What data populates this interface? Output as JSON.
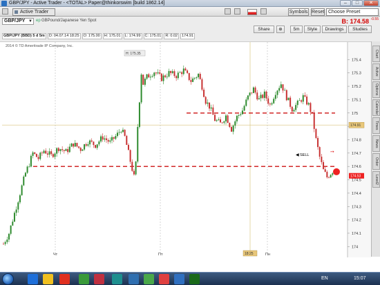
{
  "window": {
    "title": "GBP/JPY - Active Trader - <TOTAL> Paper@thinkorswim [build 1862.14]",
    "controls": {
      "minimize": "–",
      "maximize": "□",
      "close": "✕"
    }
  },
  "toolbar": {
    "active_tab": "Active Trader",
    "symbols_label": "Symbols",
    "reset_label": "Reset",
    "choose_preset_label": "Choose Preset"
  },
  "chart_header": {
    "symbol": "GBP/JPY",
    "edit_indicator": "ep",
    "description": "GBPound/Japanese Yen Spot",
    "buttons": {
      "share": "Share",
      "interval": "5m",
      "style": "Style",
      "drawings": "Drawings",
      "studies": "Studies"
    },
    "bid_text": "B: 174.58",
    "bid_change": "-0.55",
    "ohlc": {
      "symbol": "GBP/JPY (BBD) 5 d 5m",
      "date": "D: 04.07.14 18:25",
      "open": "O: 175.00",
      "high": "H: 175.01",
      "low": "L: 174.99",
      "close": "C: 175.01",
      "range": "R: 0.02",
      "last": "174.91"
    },
    "copyright": "2014 © TD Ameritrade IP Company, Inc."
  },
  "chart_data": {
    "type": "candlestick",
    "title": "",
    "xlabel": "",
    "ylabel": "",
    "ylim": [
      173.95,
      175.5
    ],
    "yticks": [
      "175.4",
      "175.3",
      "175.2",
      "175.1",
      "175",
      "174.9",
      "174.8",
      "174.7",
      "174.6",
      "174.5",
      "174.4",
      "174.3",
      "174.2",
      "174.1",
      "174"
    ],
    "xticks": [
      "Чт",
      "Пт",
      "Пн"
    ],
    "series": [
      {
        "keyframes": [
          [
            0,
            174.02
          ],
          [
            3,
            174.1
          ],
          [
            6,
            174.25
          ],
          [
            9,
            174.4
          ],
          [
            12,
            174.55
          ],
          [
            14,
            174.62
          ],
          [
            16,
            174.7
          ],
          [
            19,
            174.66
          ],
          [
            22,
            174.72
          ],
          [
            26,
            174.68
          ],
          [
            30,
            174.74
          ],
          [
            34,
            174.71
          ],
          [
            38,
            174.77
          ],
          [
            42,
            174.73
          ],
          [
            46,
            174.79
          ],
          [
            50,
            174.76
          ],
          [
            54,
            174.82
          ],
          [
            58,
            174.78
          ],
          [
            62,
            174.84
          ],
          [
            64,
            174.88
          ],
          [
            66,
            174.82
          ],
          [
            68,
            174.7
          ],
          [
            70,
            174.58
          ],
          [
            71,
            174.52
          ],
          [
            72,
            174.62
          ],
          [
            73,
            174.9
          ],
          [
            74,
            175.1
          ],
          [
            75,
            175.3
          ],
          [
            76,
            175.22
          ],
          [
            78,
            175.27
          ],
          [
            82,
            175.31
          ],
          [
            86,
            175.26
          ],
          [
            90,
            175.3
          ],
          [
            94,
            175.28
          ],
          [
            98,
            175.32
          ],
          [
            102,
            175.24
          ],
          [
            106,
            175.29
          ],
          [
            108,
            175.2
          ],
          [
            110,
            175.09
          ],
          [
            112,
            175.05
          ],
          [
            115,
            174.95
          ],
          [
            118,
            174.92
          ],
          [
            121,
            174.98
          ],
          [
            124,
            174.88
          ],
          [
            127,
            174.97
          ],
          [
            130,
            175.02
          ],
          [
            133,
            175.12
          ],
          [
            136,
            175.18
          ],
          [
            139,
            175.1
          ],
          [
            142,
            175.14
          ],
          [
            145,
            175.06
          ],
          [
            148,
            175.16
          ],
          [
            151,
            175.22
          ],
          [
            154,
            175.12
          ],
          [
            157,
            175.03
          ],
          [
            160,
            175.07
          ],
          [
            163,
            175.12
          ],
          [
            166,
            175.06
          ],
          [
            168,
            174.98
          ],
          [
            170,
            174.8
          ],
          [
            172,
            174.67
          ],
          [
            174,
            174.57
          ],
          [
            176,
            174.52
          ],
          [
            178,
            174.55
          ],
          [
            180,
            174.58
          ]
        ],
        "count": 180
      }
    ],
    "annotations": {
      "high_label": "H: 175.35",
      "sell_label": "SELL",
      "last_price_label": "174.91",
      "current_price_label": "174.53",
      "time_marker": "18:25",
      "upper_dashed_level": 175.0,
      "lower_dashed_level": 174.6,
      "last_price_level": 174.91
    },
    "grid": true
  },
  "side_tabs": [
    "Chart",
    "Active",
    "Options",
    "Calendar",
    "Times",
    "News",
    "Order",
    "Level2"
  ],
  "taskbar": {
    "language": "EN",
    "clock": "15:07",
    "icon_colors": [
      "#1e6fd9",
      "#f0c020",
      "#e03020",
      "#3a9a3a",
      "#c03040",
      "#1e8f8f",
      "#2f6fb0",
      "#4aa84a",
      "#e04040",
      "#3070c0",
      "#1a6a1a"
    ]
  },
  "colors": {
    "bull": "#2e8b2e",
    "bear": "#c83232",
    "dashed_line": "#cc1111",
    "last_price_bg": "#e8c77a",
    "current_price_bg": "#ee2222"
  }
}
